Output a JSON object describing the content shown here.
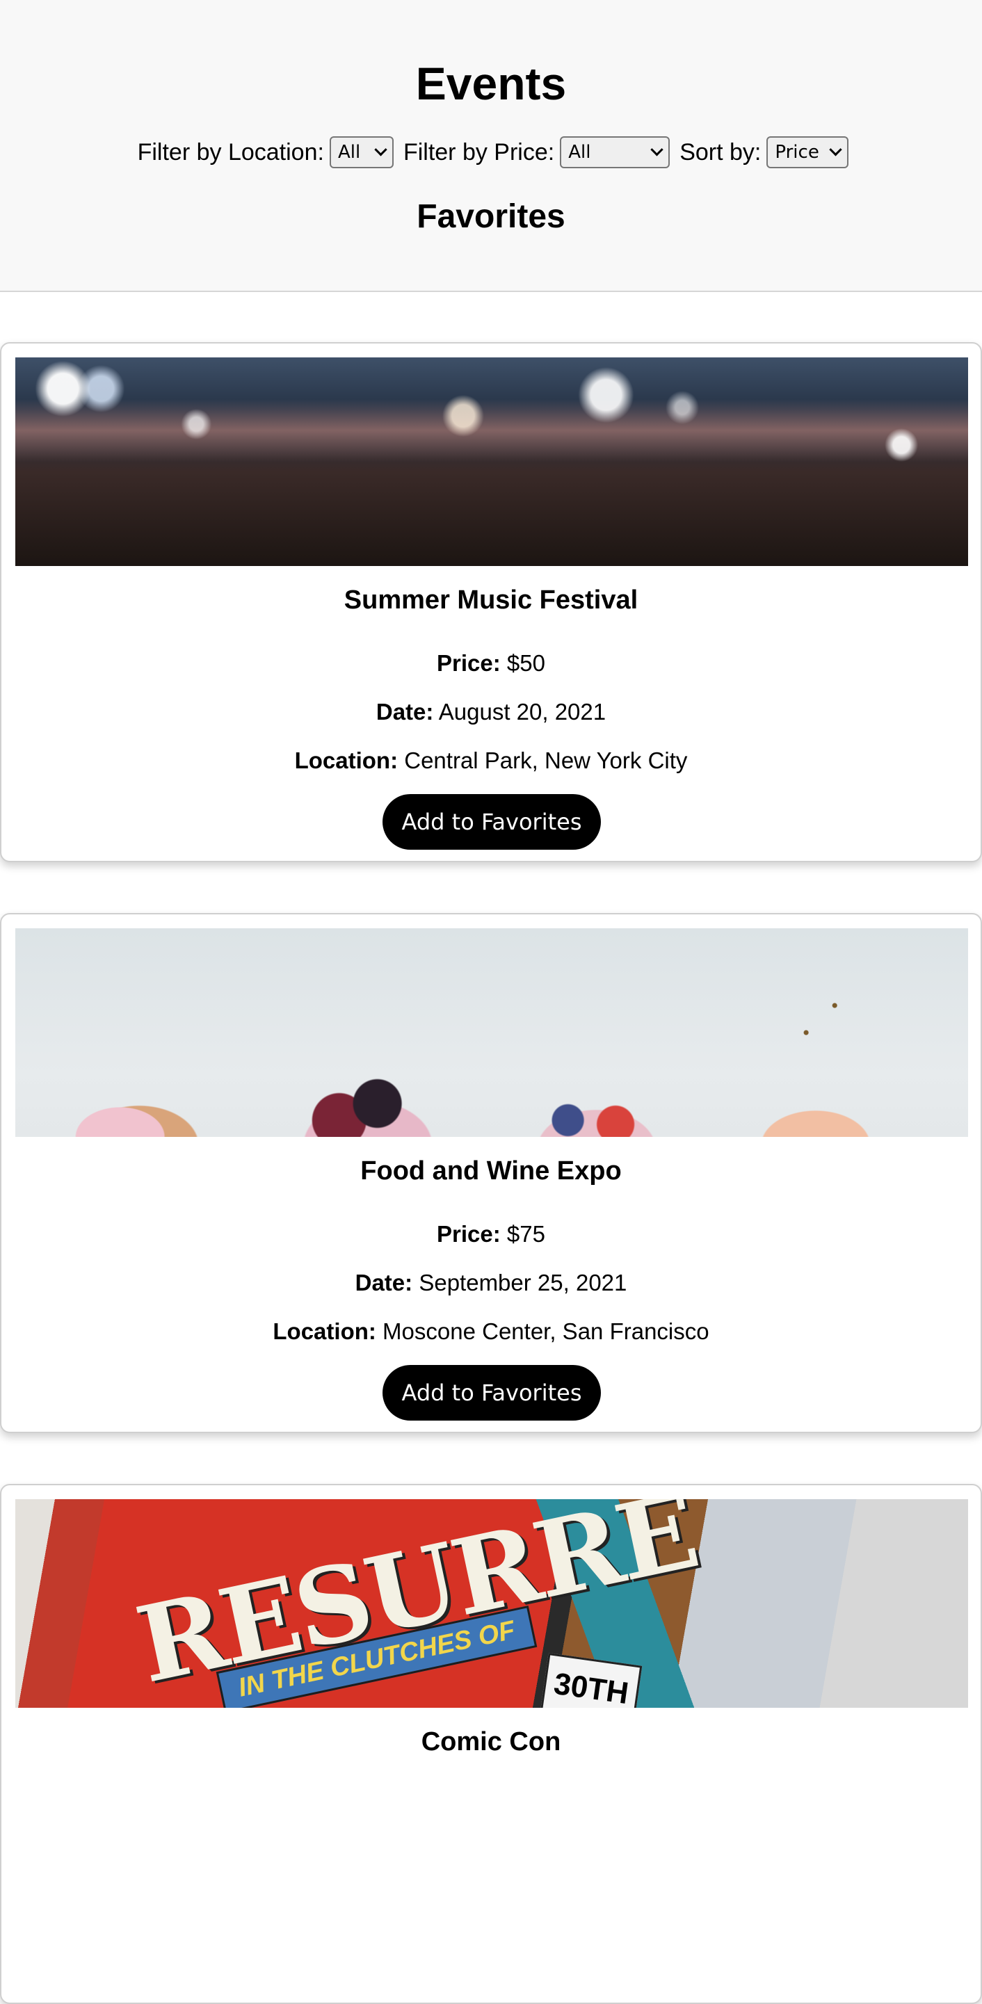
{
  "header": {
    "title": "Events",
    "filters": {
      "location_label": "Filter by Location:",
      "location_value": "All",
      "price_label": "Filter by Price:",
      "price_value": "All",
      "sort_label": "Sort by:",
      "sort_value": "Price"
    },
    "favorites_heading": "Favorites"
  },
  "labels": {
    "price": "Price:",
    "date": "Date:",
    "location": "Location:"
  },
  "events": [
    {
      "title": "Summer Music Festival",
      "price": "$50",
      "date": "August 20, 2021",
      "location": "Central Park, New York City",
      "button": "Add to Favorites"
    },
    {
      "title": "Food and Wine Expo",
      "price": "$75",
      "date": "September 25, 2021",
      "location": "Moscone Center, San Francisco",
      "button": "Add to Favorites"
    },
    {
      "title": "Comic Con"
    }
  ]
}
